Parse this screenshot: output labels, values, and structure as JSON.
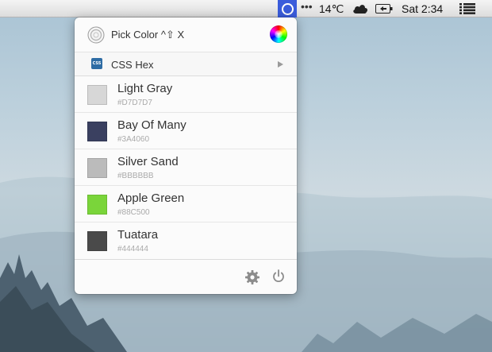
{
  "menubar": {
    "dots": "•••",
    "temperature": "14℃",
    "time": "Sat 2:34",
    "icons": [
      "color-picker-app-icon",
      "cloud-icon",
      "battery-icon",
      "list-icon"
    ]
  },
  "popover": {
    "pick_color_label": "Pick Color ^⇧ X",
    "format_icon_text": "CSS",
    "format_label": "CSS Hex",
    "colors": [
      {
        "name": "Light Gray",
        "hex": "#D7D7D7",
        "swatch": "#D7D7D7"
      },
      {
        "name": "Bay Of Many",
        "hex": "#3A4060",
        "swatch": "#3A4060"
      },
      {
        "name": "Silver Sand",
        "hex": "#BBBBBB",
        "swatch": "#BBBBBB"
      },
      {
        "name": "Apple Green",
        "hex": "#88C500",
        "swatch": "#7AD53A"
      },
      {
        "name": "Tuatara",
        "hex": "#444444",
        "swatch": "#4A4A4A"
      }
    ]
  },
  "theme": {
    "accent": "#3a5cdb"
  }
}
